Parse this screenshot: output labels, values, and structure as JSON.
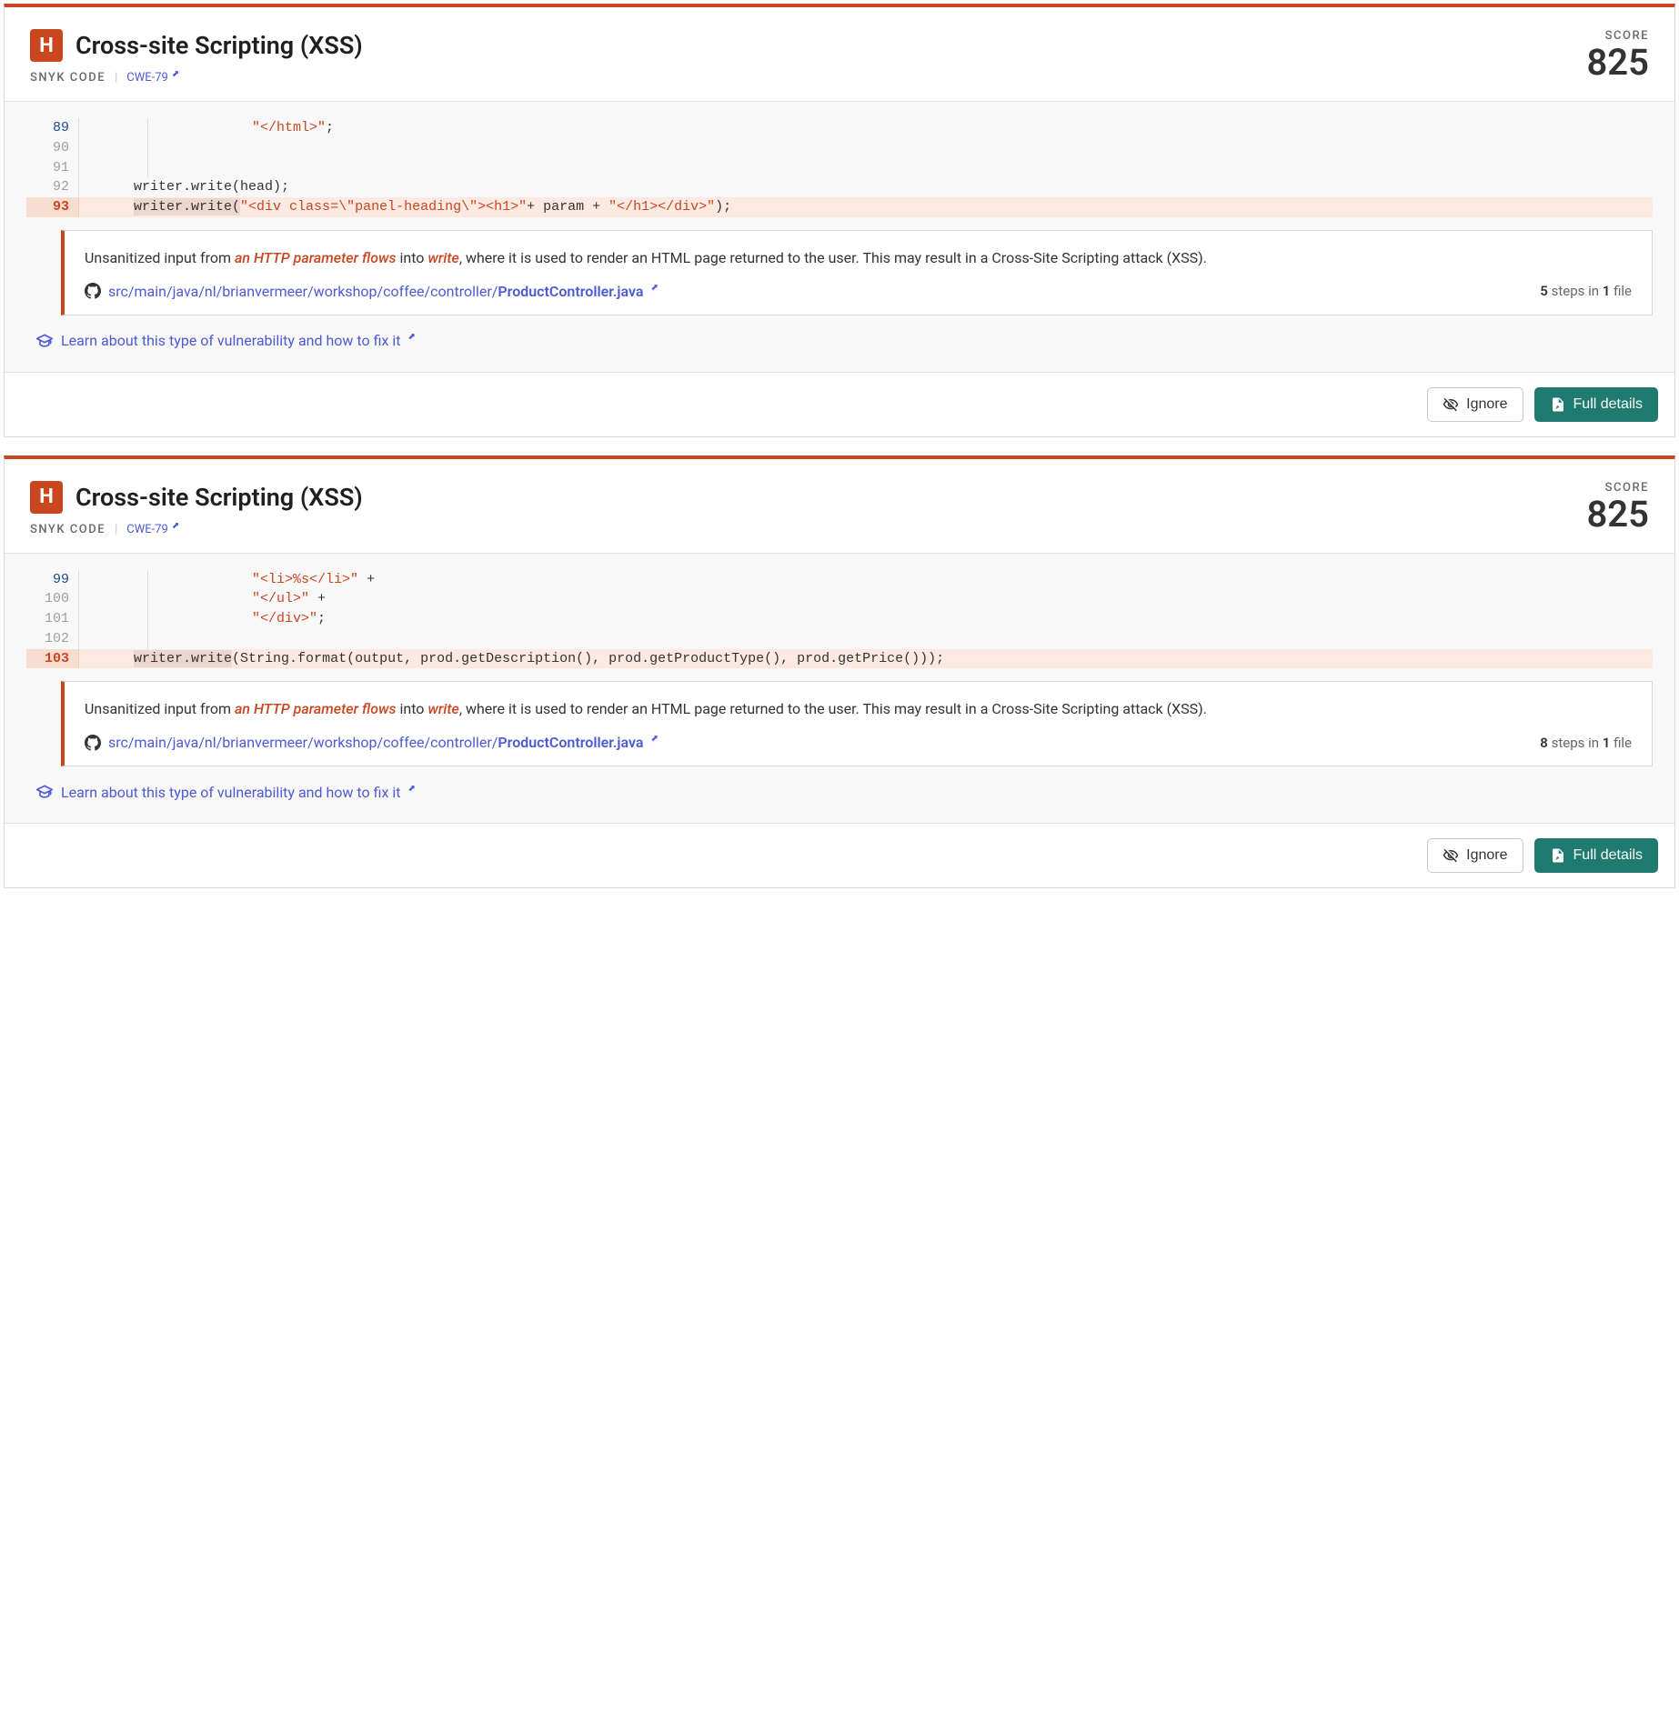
{
  "cards": [
    {
      "severity": "H",
      "title": "Cross-site Scripting (XSS)",
      "source": "SNYK CODE",
      "cwe": "CWE-79",
      "score_label": "SCORE",
      "score": "825",
      "code": [
        {
          "n": "89",
          "cls": "active",
          "gutter": true,
          "html": "            <span class=\"tok-str\">\"&lt;/html&gt;\"</span>;"
        },
        {
          "n": "90",
          "cls": "",
          "gutter": true,
          "html": ""
        },
        {
          "n": "91",
          "cls": "",
          "gutter": true,
          "html": ""
        },
        {
          "n": "92",
          "cls": "",
          "gutter": false,
          "html": "      writer.write(head);"
        },
        {
          "n": "93",
          "cls": "hl",
          "gutter": false,
          "html": "      <span class=\"tok-sel\">writer.write(</span><span class=\"tok-str\">\"&lt;div class=\\\"panel-heading\\\"&gt;&lt;h1&gt;\"</span>+ param + <span class=\"tok-str\">\"&lt;/h1&gt;&lt;/div&gt;\"</span>);"
        }
      ],
      "explain_pre": "Unsanitized input from ",
      "explain_em1": "an HTTP parameter flows",
      "explain_mid1": " into ",
      "explain_em2": "write",
      "explain_post": ", where it is used to render an HTML page returned to the user. This may result in a Cross-Site Scripting attack (XSS).",
      "file_path": "src/main/java/nl/brianvermeer/workshop/coffee/controller/",
      "file_name": "ProductController.java",
      "steps": "5",
      "files": "1",
      "learn": "Learn about this type of vulnerability and how to fix it",
      "ignore_label": "Ignore",
      "details_label": "Full details"
    },
    {
      "severity": "H",
      "title": "Cross-site Scripting (XSS)",
      "source": "SNYK CODE",
      "cwe": "CWE-79",
      "score_label": "SCORE",
      "score": "825",
      "code": [
        {
          "n": "99",
          "cls": "active",
          "gutter": true,
          "html": "            <span class=\"tok-str\">\"&lt;li&gt;%s&lt;/li&gt;\"</span> +"
        },
        {
          "n": "100",
          "cls": "",
          "gutter": true,
          "html": "            <span class=\"tok-str\">\"&lt;/ul&gt;\"</span> +"
        },
        {
          "n": "101",
          "cls": "",
          "gutter": true,
          "html": "            <span class=\"tok-str\">\"&lt;/div&gt;\"</span>;"
        },
        {
          "n": "102",
          "cls": "",
          "gutter": true,
          "html": ""
        },
        {
          "n": "103",
          "cls": "hl",
          "gutter": false,
          "html": "      <span class=\"tok-sel\">writer.write</span>(String.format(output, prod.getDescription(), prod.getProductType(), prod.getPrice()));"
        }
      ],
      "explain_pre": "Unsanitized input from ",
      "explain_em1": "an HTTP parameter flows",
      "explain_mid1": " into ",
      "explain_em2": "write",
      "explain_post": ", where it is used to render an HTML page returned to the user. This may result in a Cross-Site Scripting attack (XSS).",
      "file_path": "src/main/java/nl/brianvermeer/workshop/coffee/controller/",
      "file_name": "ProductController.java",
      "steps": "8",
      "files": "1",
      "learn": "Learn about this type of vulnerability and how to fix it",
      "ignore_label": "Ignore",
      "details_label": "Full details"
    }
  ],
  "steps_word": "steps in",
  "file_word": "file"
}
